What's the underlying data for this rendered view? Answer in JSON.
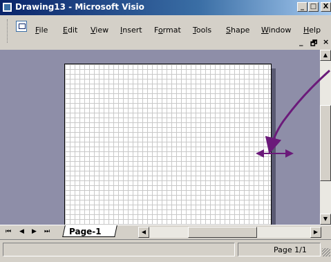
{
  "window": {
    "title": "Drawing13 - Microsoft Visio"
  },
  "titlebar_buttons": {
    "minimize": "_",
    "maximize": "□",
    "close": "X"
  },
  "menu": {
    "items": [
      {
        "label": "File",
        "accel": "F",
        "rest": "ile"
      },
      {
        "label": "Edit",
        "accel": "E",
        "rest": "dit"
      },
      {
        "label": "View",
        "accel": "V",
        "rest": "iew"
      },
      {
        "label": "Insert",
        "accel": "I",
        "rest": "nsert"
      },
      {
        "label": "Format",
        "accel": "o",
        "prefix": "F",
        "rest": "rmat"
      },
      {
        "label": "Tools",
        "accel": "T",
        "rest": "ools"
      },
      {
        "label": "Shape",
        "accel": "S",
        "rest": "hape"
      },
      {
        "label": "Window",
        "accel": "W",
        "rest": "indow"
      },
      {
        "label": "Help",
        "accel": "H",
        "rest": "elp"
      }
    ],
    "mdi": {
      "minimize": "_",
      "restore": "🗗",
      "close": "×"
    }
  },
  "page_nav": {
    "first": "⏮",
    "prev": "◀",
    "next": "▶",
    "last": "⏭",
    "tab_label": "Page-1"
  },
  "status": {
    "page": "Page 1/1"
  },
  "annotation": {
    "arrow_color": "#6b1a7a"
  },
  "colors": {
    "title_start": "#0a246a",
    "title_end": "#a6caf0",
    "workspace": "#8e8ea8"
  }
}
